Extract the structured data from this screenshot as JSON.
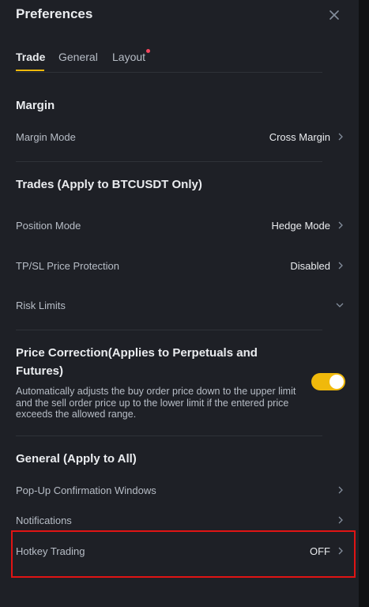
{
  "header": {
    "title": "Preferences",
    "close_icon": "close-icon"
  },
  "tabs": [
    {
      "label": "Trade",
      "active": true
    },
    {
      "label": "General",
      "active": false
    },
    {
      "label": "Layout",
      "active": false,
      "has_dot": true
    }
  ],
  "margin": {
    "title": "Margin",
    "rows": [
      {
        "label": "Margin Mode",
        "value": "Cross Margin"
      }
    ]
  },
  "trades": {
    "title": "Trades (Apply to BTCUSDT Only)",
    "rows": [
      {
        "label": "Position Mode",
        "value": "Hedge Mode"
      },
      {
        "label": "TP/SL Price Protection",
        "value": "Disabled"
      },
      {
        "label": "Risk Limits",
        "value": ""
      }
    ]
  },
  "price_correction": {
    "title": "Price Correction(Applies to Perpetuals and Futures)",
    "description": "Automatically adjusts the buy order price down to the upper limit and the sell order price up to the lower limit if the entered price exceeds the allowed range.",
    "enabled": true
  },
  "general": {
    "title": "General (Apply to All)",
    "rows": [
      {
        "label": "Pop-Up Confirmation Windows",
        "value": ""
      },
      {
        "label": "Notifications",
        "value": ""
      },
      {
        "label": "Hotkey Trading",
        "value": "OFF"
      }
    ]
  },
  "colors": {
    "accent": "#f0b90b",
    "background": "#1e2026",
    "highlight_border": "#e01414",
    "notification_dot": "#f6465d"
  }
}
